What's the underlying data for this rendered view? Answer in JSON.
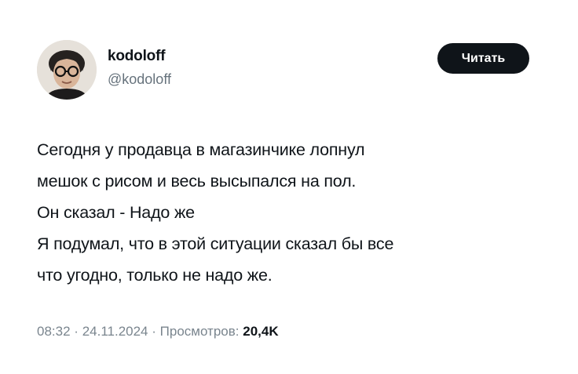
{
  "author": {
    "display_name": "kodoloff",
    "handle": "@kodoloff",
    "avatar_icon": "person-with-glasses-avatar"
  },
  "follow_button": {
    "label": "Читать"
  },
  "tweet": {
    "lines": [
      "Сегодня у продавца в магазинчике лопнул",
      "мешок с рисом и весь высыпался на пол.",
      "Он сказал - Надо же",
      "Я подумал, что в этой ситуации сказал бы все",
      "что угодно, только не надо же."
    ]
  },
  "meta": {
    "time": "08:32",
    "separator": "·",
    "date": "24.11.2024",
    "views_label": "Просмотров:",
    "views_count": "20,4K"
  },
  "colors": {
    "text": "#0f1419",
    "secondary": "#66727c",
    "button_bg": "#0f1419",
    "button_text": "#ffffff"
  }
}
